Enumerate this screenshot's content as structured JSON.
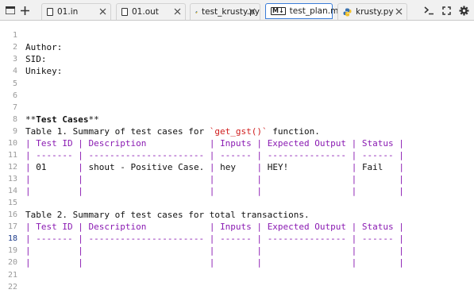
{
  "toolbar": {
    "new_tab_icon": "plus-icon",
    "menu_icon": "menu-icon",
    "tabs": [
      {
        "label": "01.in",
        "icon": "document-icon"
      },
      {
        "label": "01.out",
        "icon": "document-icon"
      },
      {
        "label": "test_krusty.py",
        "icon": "python-icon"
      },
      {
        "label": "test_plan.md",
        "icon": "markdown-icon",
        "active": true
      },
      {
        "label": "krusty.py",
        "icon": "python-icon"
      }
    ],
    "right_icons": [
      "terminal-icon",
      "fullscreen-icon",
      "settings-icon"
    ]
  },
  "editor": {
    "current_line": 18,
    "line_numbers": [
      "1",
      "2",
      "3",
      "4",
      "5",
      "6",
      "7",
      "8",
      "9",
      "10",
      "11",
      "12",
      "13",
      "14",
      "15",
      "16",
      "17",
      "18",
      "19",
      "20",
      "21",
      "22"
    ],
    "lines": {
      "l1": "Author:",
      "l2": "SID:",
      "l3": "Unikey:",
      "l7_stars": "**",
      "l7_title": "Test Cases",
      "l8_pre": "Table 1. Summary of test cases for ",
      "l8_code": "`get_gst()`",
      "l8_post": " function.",
      "l9_cells": [
        "Test ID",
        "Description",
        "Inputs",
        "Expected Output",
        "Status"
      ],
      "l10_cells": [
        "-------",
        "----------------------",
        "------",
        "---------------",
        "------"
      ],
      "l11_cells": [
        "01",
        "shout - Positive Case.",
        "hey",
        "HEY!",
        "Fail"
      ],
      "l15": "Table 2. Summary of test cases for total transactions.",
      "l16_cells": [
        "Test ID",
        "Description",
        "Inputs",
        "Expected Output",
        "Status"
      ],
      "l17_cells": [
        "-------",
        "----------------------",
        "------",
        "---------------",
        "------"
      ]
    }
  },
  "colors": {
    "pipe": "#8a1ab2",
    "code_span": "#d01c1c",
    "active_tab_border": "#3b7dd8",
    "gutter": "#9a9a9a"
  }
}
